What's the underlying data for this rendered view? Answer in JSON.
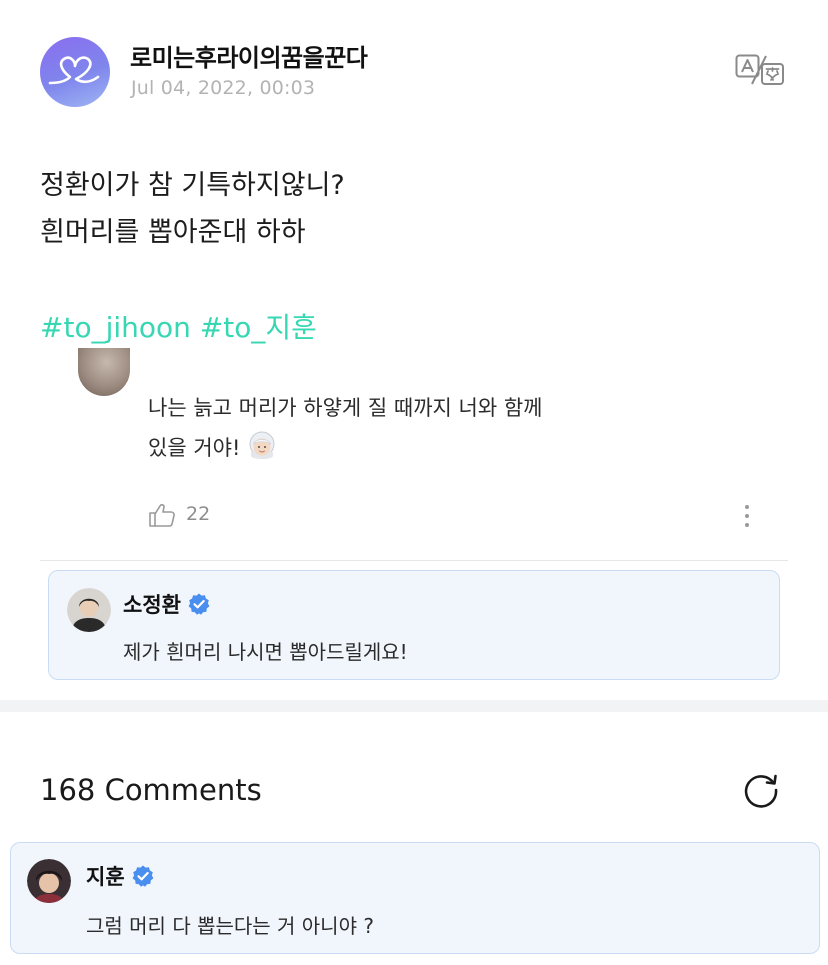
{
  "post": {
    "author": "로미는후라이의꿈을꾼다",
    "date": "Jul 04, 2022, 00:03",
    "body_lines": [
      "정환이가 참 기특하지않니?",
      "흰머리를 뽑아준대 하하"
    ],
    "hashtags": [
      "#to_jihoon",
      "#to_지훈"
    ],
    "accent_color": "#37d7b3"
  },
  "quoted_comment": {
    "text_lines": [
      "나는 늙고 머리가 하얗게 질 때까지 너와 함께",
      "있을 거야!"
    ],
    "emoji": "old-woman-emoji",
    "like_count": "22"
  },
  "artist_reply": {
    "name": "소정환",
    "verified": true,
    "text": "제가 흰머리 나시면 뽑아드릴게요!"
  },
  "comments": {
    "count_label": "168 Comments",
    "items": [
      {
        "name": "지훈",
        "verified": true,
        "text": "그럼 머리 다 뽑는다는 거 아니야 ?"
      }
    ]
  },
  "icons": {
    "translate": "translate-icon",
    "like": "thumbs-up-icon",
    "more": "more-vertical-icon",
    "refresh": "refresh-icon",
    "verified": "verified-badge-icon"
  },
  "colors": {
    "verified_blue": "#4a8ef0",
    "reply_background": "#f1f6fd",
    "reply_border": "#c9dcf3"
  }
}
